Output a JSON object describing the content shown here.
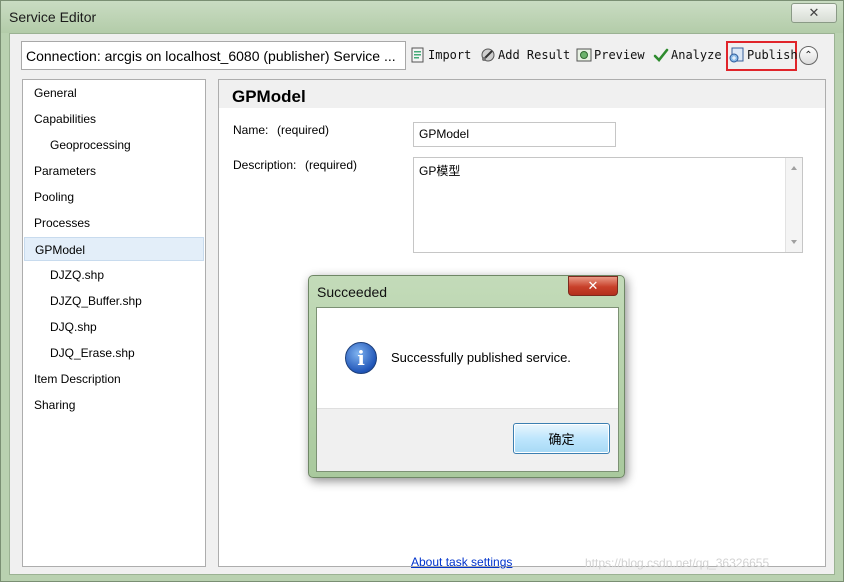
{
  "window": {
    "title": "Service Editor",
    "close_glyph": "✕"
  },
  "toolbar": {
    "connection": "Connection: arcgis on localhost_6080 (publisher)   Service ...",
    "import_label": "Import",
    "add_result_label": "Add Result",
    "preview_label": "Preview",
    "analyze_label": "Analyze",
    "publish_label": "Publish",
    "collapse_glyph": "⌃"
  },
  "sidebar": {
    "items": [
      {
        "label": "General"
      },
      {
        "label": "Capabilities"
      },
      {
        "label": "Geoprocessing"
      },
      {
        "label": "Parameters"
      },
      {
        "label": "Pooling"
      },
      {
        "label": "Processes"
      },
      {
        "label": "GPModel"
      },
      {
        "label": "DJZQ.shp"
      },
      {
        "label": "DJZQ_Buffer.shp"
      },
      {
        "label": "DJQ.shp"
      },
      {
        "label": "DJQ_Erase.shp"
      },
      {
        "label": "Item Description"
      },
      {
        "label": "Sharing"
      }
    ]
  },
  "panel": {
    "title": "GPModel",
    "name_label": "Name:",
    "name_required": "(required)",
    "name_value": "GPModel",
    "description_label": "Description:",
    "description_required": "(required)",
    "description_value": "GP模型",
    "about_link": "About task settings"
  },
  "dialog": {
    "title": "Succeeded",
    "close_glyph": "✕",
    "message": "Successfully published service.",
    "icon_glyph": "i",
    "ok_label": "确定"
  },
  "watermark": "https://blog.csdn.net/qq_36326655",
  "colors": {
    "window_frame": "#b9d1b0",
    "highlight_frame": "#e0242a",
    "link": "#0033cc",
    "selected_item": "#e3eef9"
  }
}
